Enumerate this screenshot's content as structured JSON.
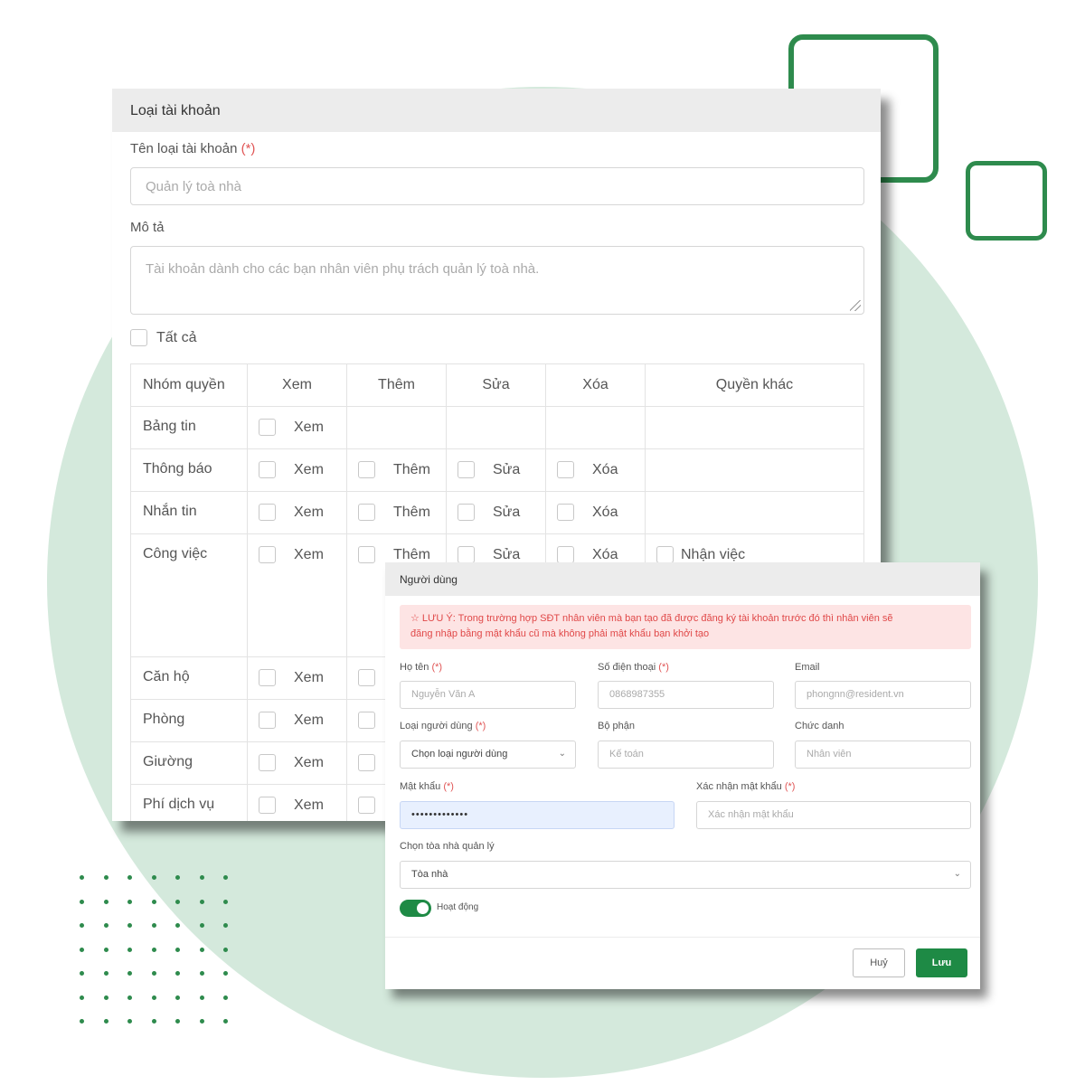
{
  "colors": {
    "brand_green": "#2e8b4d",
    "background_circle": "#d4e9dc",
    "alert_bg": "#fde4e4",
    "alert_text": "#e04848"
  },
  "account_type_form": {
    "title": "Loại tài khoản",
    "name_label": "Tên loại tài khoản",
    "required_mark": "(*)",
    "name_value": "Quản lý toà nhà",
    "description_label": "Mô tả",
    "description_value": "Tài khoản dành cho các bạn nhân viên phụ trách quản lý toà nhà.",
    "select_all_label": "Tất cả",
    "table": {
      "headers": [
        "Nhóm quyền",
        "Xem",
        "Thêm",
        "Sửa",
        "Xóa",
        "Quyền khác"
      ],
      "rows": [
        {
          "group": "Bảng tin",
          "view": "Xem",
          "add": "",
          "edit": "",
          "delete": "",
          "other": ""
        },
        {
          "group": "Thông báo",
          "view": "Xem",
          "add": "Thêm",
          "edit": "Sửa",
          "delete": "Xóa",
          "other": ""
        },
        {
          "group": "Nhắn tin",
          "view": "Xem",
          "add": "Thêm",
          "edit": "Sửa",
          "delete": "Xóa",
          "other": ""
        },
        {
          "group": "Công việc",
          "view": "Xem",
          "add": "Thêm",
          "edit": "Sửa",
          "delete": "Xóa",
          "other": "Nhận việc"
        },
        {
          "group": "Căn hộ",
          "view": "Xem"
        },
        {
          "group": "Phòng",
          "view": "Xem"
        },
        {
          "group": "Giường",
          "view": "Xem"
        },
        {
          "group": "Phí dịch vụ",
          "view": "Xem"
        }
      ]
    }
  },
  "user_modal": {
    "title": "Người dùng",
    "alert_line1": "☆ LƯU Ý: Trong trường hợp SĐT nhân viên mà bạn tạo đã được đăng ký tài khoản trước đó thì nhân viên sẽ",
    "alert_line2": "đăng nhập bằng mật khẩu cũ mà không phải mật khẩu bạn khởi tạo",
    "required_mark": "(*)",
    "fullname_label": "Họ tên",
    "fullname_placeholder": "Nguyễn Văn A",
    "phone_label": "Số điện thoại",
    "phone_placeholder": "0868987355",
    "email_label": "Email",
    "email_placeholder": "phongnn@resident.vn",
    "user_type_label": "Loại người dùng",
    "user_type_value": "Chọn loại người dùng",
    "department_label": "Bộ phận",
    "department_placeholder": "Kế toán",
    "title_label": "Chức danh",
    "title_placeholder": "Nhân viên",
    "password_label": "Mật khẩu",
    "password_value": "•••••••••••••",
    "confirm_password_label": "Xác nhận mật khẩu",
    "confirm_password_placeholder": "Xác nhận mật khẩu",
    "building_label": "Chọn tòa nhà quản lý",
    "building_value": "Tòa nhà",
    "active_label": "Hoạt động",
    "active": true,
    "cancel_label": "Huỷ",
    "save_label": "Lưu"
  }
}
